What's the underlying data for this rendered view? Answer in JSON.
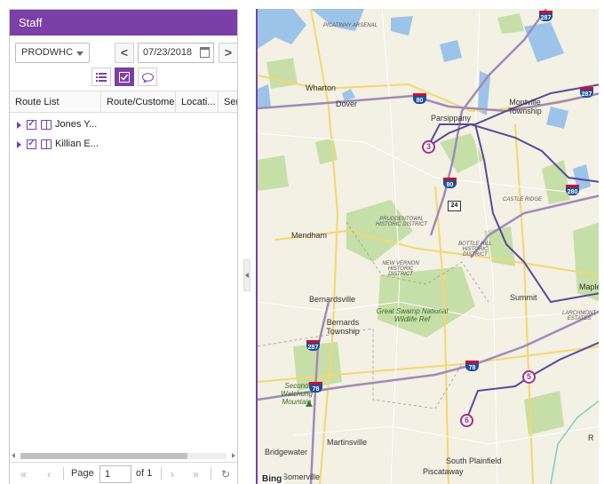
{
  "panel": {
    "title": "Staff",
    "selector_value": "PRODWHC",
    "date_value": "07/23/2018",
    "prev_label": "<",
    "next_label": ">",
    "view_buttons": [
      "list-icon",
      "check-icon",
      "comment-icon"
    ]
  },
  "grid": {
    "columns": [
      "Route List",
      "Route/Customer",
      "Locati...",
      "Ser"
    ],
    "rows": [
      {
        "label": "Jones Y...",
        "checked": true
      },
      {
        "label": "Killian E...",
        "checked": true
      }
    ]
  },
  "pager": {
    "first": "«",
    "prev": "‹",
    "page_label": "Page",
    "page_value": "1",
    "of_label": "of 1",
    "next": "›",
    "last": "»",
    "refresh": "↻"
  },
  "map": {
    "attribution": "Bing",
    "places": [
      "Picatinny Arsenal",
      "Wharton",
      "Dover",
      "Parsippany",
      "Montville Township",
      "Mendham",
      "Bernardsville",
      "Bernards Township",
      "Summit",
      "Maple",
      "Martinsville",
      "Bridgewater",
      "South Plainfield",
      "Piscataway",
      "Somerville",
      "R"
    ],
    "districts": [
      "Pruddentown, Historic District",
      "Bottle Hill Historic District",
      "New Vernon Historic District",
      "Castle Ridge",
      "Larchmont Estates"
    ],
    "parks": [
      "Great Swamp National Wildlife Ref",
      "Second Watchung Mountain"
    ],
    "interstates": [
      "80",
      "287",
      "287",
      "80",
      "280",
      "287",
      "78",
      "78"
    ],
    "state_routes": [
      "24"
    ],
    "markers": [
      "3",
      "5",
      "6"
    ],
    "route_color": "#5a4a9a",
    "marker_color": "#a0308c"
  },
  "colors": {
    "accent": "#7b3fa8"
  }
}
